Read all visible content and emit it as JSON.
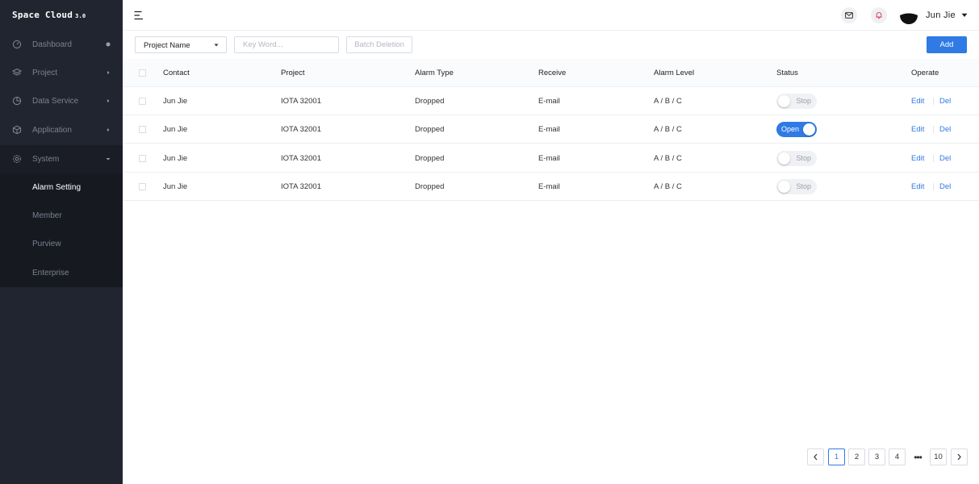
{
  "app": {
    "logo": "Space Cloud",
    "version": "3.0"
  },
  "sidebar": {
    "items": [
      {
        "label": "Dashboard",
        "icon": "dashboard-icon",
        "indicator": "dot"
      },
      {
        "label": "Project",
        "icon": "layers-icon",
        "indicator": "chevron-right"
      },
      {
        "label": "Data Service",
        "icon": "pie-chart-icon",
        "indicator": "chevron-right"
      },
      {
        "label": "Application",
        "icon": "cube-icon",
        "indicator": "chevron-right"
      },
      {
        "label": "System",
        "icon": "gear-icon",
        "indicator": "caret-down",
        "expanded": true
      }
    ],
    "subitems": [
      {
        "label": "Alarm Setting",
        "active": true
      },
      {
        "label": "Member"
      },
      {
        "label": "Purview"
      },
      {
        "label": "Enterprise"
      }
    ]
  },
  "header": {
    "icons": [
      "menu-icon",
      "mail-icon",
      "bell-icon"
    ],
    "user": {
      "name": "Jun Jie"
    }
  },
  "toolbar": {
    "select": {
      "value": "Project Name"
    },
    "keyword": {
      "placeholder": "Key Word..."
    },
    "batch_label": "Batch Deletion",
    "add_label": "Add"
  },
  "table": {
    "columns": [
      "Contact",
      "Project",
      "Alarm Type",
      "Receive",
      "Alarm Level",
      "Status",
      "Operate"
    ],
    "rows": [
      {
        "contact": "Jun Jie",
        "project": "IOTA 32001",
        "alarm_type": "Dropped",
        "receive": "E-mail",
        "alarm_level": "A / B / C",
        "status": "Stop",
        "status_on": false,
        "edit": "Edit",
        "del": "Del"
      },
      {
        "contact": "Jun Jie",
        "project": "IOTA 32001",
        "alarm_type": "Dropped",
        "receive": "E-mail",
        "alarm_level": "A / B / C",
        "status": "Open",
        "status_on": true,
        "edit": "Edit",
        "del": "Del"
      },
      {
        "contact": "Jun Jie",
        "project": "IOTA 32001",
        "alarm_type": "Dropped",
        "receive": "E-mail",
        "alarm_level": "A / B / C",
        "status": "Stop",
        "status_on": false,
        "edit": "Edit",
        "del": "Del"
      },
      {
        "contact": "Jun Jie",
        "project": "IOTA 32001",
        "alarm_type": "Dropped",
        "receive": "E-mail",
        "alarm_level": "A / B / C",
        "status": "Stop",
        "status_on": false,
        "edit": "Edit",
        "del": "Del"
      }
    ]
  },
  "pagination": {
    "pages": [
      "1",
      "2",
      "3",
      "4"
    ],
    "ellipsis": "•••",
    "last": "10",
    "current": "1"
  },
  "colors": {
    "sidebar_bg": "#212530",
    "submenu_bg": "#161920",
    "accent": "#2f7ae5",
    "border": "#d9dce3"
  }
}
